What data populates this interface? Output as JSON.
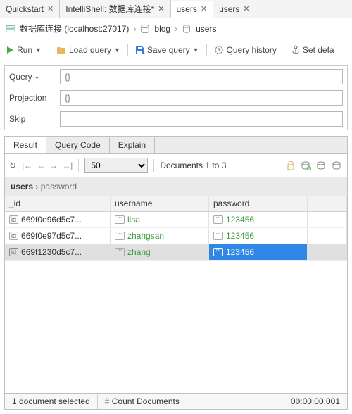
{
  "tabs": [
    {
      "label": "Quickstart",
      "active": false
    },
    {
      "label": "IntelliShell: 数据库连接*",
      "active": false
    },
    {
      "label": "users",
      "active": true
    },
    {
      "label": "users",
      "active": false
    }
  ],
  "breadcrumb": {
    "conn": "数据库连接 (localhost:27017)",
    "db": "blog",
    "coll": "users"
  },
  "toolbar": {
    "run": "Run",
    "load": "Load query",
    "save": "Save query",
    "history": "Query history",
    "setdef": "Set defa"
  },
  "query": {
    "query_label": "Query",
    "query_val": "{}",
    "proj_label": "Projection",
    "proj_val": "{}",
    "skip_label": "Skip",
    "skip_val": ""
  },
  "rtabs": {
    "result": "Result",
    "code": "Query Code",
    "explain": "Explain"
  },
  "rbar": {
    "limit": "50",
    "docs": "Documents 1 to 3"
  },
  "rpath": {
    "coll": "users",
    "field": "password"
  },
  "columns": {
    "id": "_id",
    "user": "username",
    "pass": "password"
  },
  "rows": [
    {
      "id": "669f0e96d5c7...",
      "user": "lisa",
      "pass": "123456",
      "sel": false
    },
    {
      "id": "669f0e97d5c7...",
      "user": "zhangsan",
      "pass": "123456",
      "sel": false
    },
    {
      "id": "669f1230d5c7...",
      "user": "zhang",
      "pass": "123456",
      "sel": true
    }
  ],
  "status": {
    "sel": "1 document selected",
    "count": "Count Documents",
    "time": "00:00:00.001"
  }
}
